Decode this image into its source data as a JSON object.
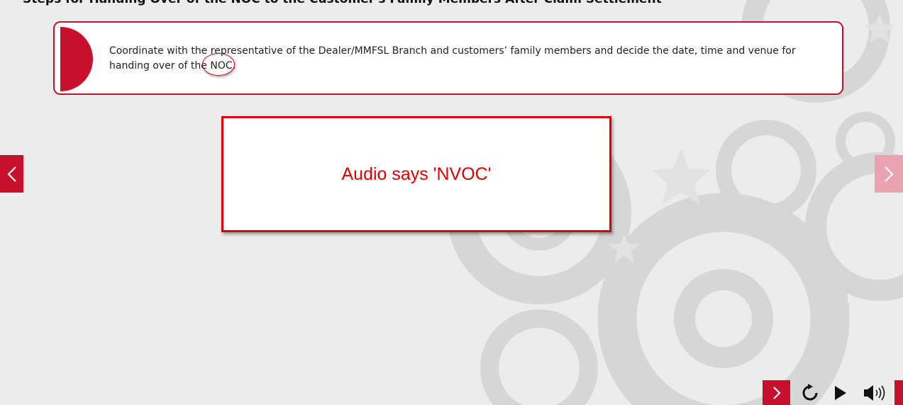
{
  "page": {
    "title": "Steps for Handing Over of the NOC to the Customer's Family Members After Claim Settlement"
  },
  "instruction": {
    "text_before": "Coordinate with the representative of the Dealer/MMFSL Branch and customers’ family members and decide the date, time and venue for handing over of the ",
    "highlight": "NOC",
    "text_after": "."
  },
  "annotation": {
    "text": "Audio says 'NVOC'"
  },
  "icons": {
    "prev": "chevron-left-icon",
    "next": "chevron-right-icon",
    "replay": "replay-icon",
    "play": "play-icon",
    "audio": "speaker-icon"
  },
  "colors": {
    "brand_red": "#c8102e",
    "annotation_red": "#e00000",
    "next_arrow_faded": "#e8a3ae",
    "background": "#ececec"
  }
}
